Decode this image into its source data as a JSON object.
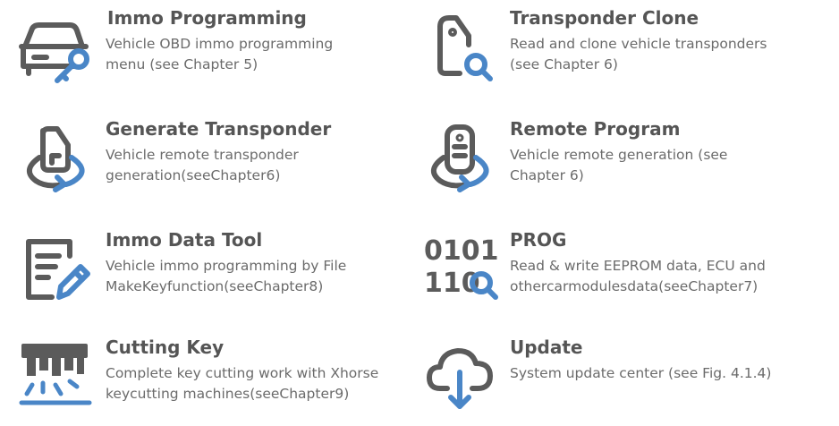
{
  "colors": {
    "icon_gray": "#5b5b5b",
    "accent_blue": "#4a86c7",
    "text": "#6b6b6b",
    "title": "#555555"
  },
  "items": [
    {
      "icon": "car-key-icon",
      "title": "Immo Programming",
      "lines": [
        "Vehicle OBD immo programming",
        "menu (see Chapter 5)"
      ]
    },
    {
      "icon": "transponder-search-icon",
      "title": "Transponder Clone",
      "lines": [
        "Read and clone vehicle transponders",
        "(see Chapter 6)"
      ]
    },
    {
      "icon": "transponder-cycle-icon",
      "title": "Generate Transponder",
      "lines": [
        "Vehicle remote transponder",
        "generation(seeChapter6)"
      ]
    },
    {
      "icon": "remote-cycle-icon",
      "title": "Remote Program",
      "lines": [
        "Vehicle remote generation (see",
        "Chapter 6)"
      ]
    },
    {
      "icon": "document-edit-icon",
      "title": "Immo Data Tool",
      "lines": [
        "Vehicle immo programming by File",
        "MakeKeyfunction(seeChapter8)"
      ]
    },
    {
      "icon": "binary-search-icon",
      "icon_text": [
        "0101",
        "110"
      ],
      "title": "PROG",
      "lines": [
        "Read & write EEPROM data, ECU and",
        "othercarmodulesdata(seeChapter7)"
      ]
    },
    {
      "icon": "key-cutter-icon",
      "title": "Cutting Key",
      "lines": [
        "Complete key cutting work with Xhorse",
        "keycutting machines(seeChapter9)"
      ]
    },
    {
      "icon": "cloud-download-icon",
      "title": "Update",
      "lines": [
        "System update center (see Fig. 4.1.4)"
      ]
    }
  ]
}
